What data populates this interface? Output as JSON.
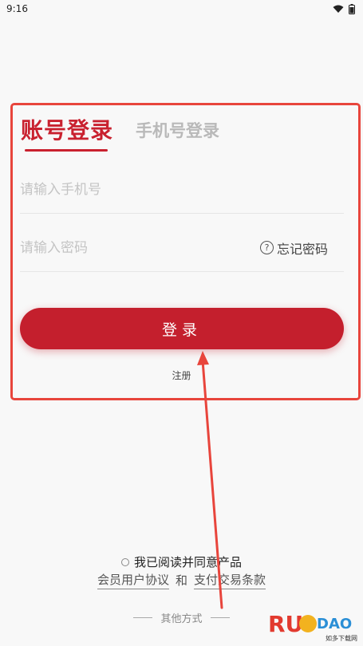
{
  "status": {
    "time": "9:16"
  },
  "tabs": {
    "account": "账号登录",
    "phone": "手机号登录"
  },
  "fields": {
    "phone_placeholder": "请输入手机号",
    "password_placeholder": "请输入密码",
    "forgot": "忘记密码"
  },
  "login_button": "登录",
  "register": "注册",
  "agreement": {
    "text": "我已阅读并同意产品",
    "member_agreement": "会员用户协议",
    "and": "和",
    "payment_terms": "支付交易条款"
  },
  "other_methods": "其他方式",
  "watermark": {
    "logo_text": "RUANDAOO",
    "site_text": "如多下载网"
  },
  "colors": {
    "brand": "#c41f2d",
    "annotation": "#e8453c"
  }
}
